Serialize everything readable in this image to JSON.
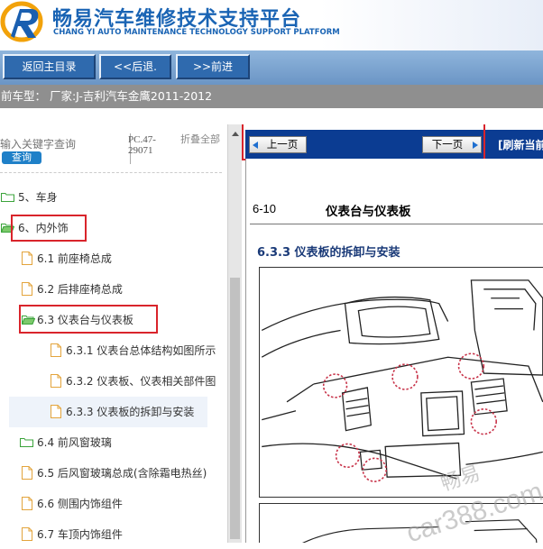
{
  "header": {
    "title_cn": "畅易汽车维修技术支持平台",
    "title_en": "CHANG YI AUTO MAINTENANCE TECHNOLOGY SUPPORT PLATFORM"
  },
  "nav": {
    "home_label": "返回主目录",
    "back_label": "<<后退.",
    "forward_label": ">>前进"
  },
  "car_bar": {
    "text": "前车型： 厂家:J-吉利汽车金鹰2011-2012"
  },
  "search": {
    "placeholder": "输入关键字查询",
    "button_label": "查询",
    "code": "PC.47-29071",
    "fold_label": "折叠全部"
  },
  "tree": [
    {
      "label": "5、车身",
      "icon": "folder-icon"
    },
    {
      "label": "6、内外饰",
      "icon": "folder-open-icon"
    },
    {
      "label": "6.1 前座椅总成",
      "icon": "document-icon"
    },
    {
      "label": "6.2 后排座椅总成",
      "icon": "document-icon"
    },
    {
      "label": "6.3 仪表台与仪表板",
      "icon": "folder-open-icon"
    },
    {
      "label": "6.3.1 仪表台总体结构如图所示",
      "icon": "document-icon"
    },
    {
      "label": "6.3.2 仪表板、仪表相关部件图",
      "icon": "document-icon"
    },
    {
      "label": "6.3.3 仪表板的拆卸与安装",
      "icon": "document-icon",
      "selected": true
    },
    {
      "label": "6.4 前风窗玻璃",
      "icon": "folder-icon"
    },
    {
      "label": "6.5 后风窗玻璃总成(含除霜电热丝)",
      "icon": "document-icon"
    },
    {
      "label": "6.6 侧围内饰组件",
      "icon": "document-icon"
    },
    {
      "label": "6.7 车顶内饰组件",
      "icon": "document-icon"
    }
  ],
  "pager": {
    "prev_label": "上一页",
    "next_label": "下一页",
    "refresh_label": "[刷新当前"
  },
  "content": {
    "section_number": "6-10",
    "section_title": "仪表台与仪表板",
    "subsection_title": "6.3.3 仪表板的拆卸与安装"
  },
  "watermark": {
    "line1": "畅易",
    "line2": "car388.com"
  },
  "colors": {
    "brand_blue": "#1a64b4",
    "nav_button": "#2f6aae",
    "pager_bar": "#0b3c92",
    "highlight_red": "#d9242b"
  }
}
